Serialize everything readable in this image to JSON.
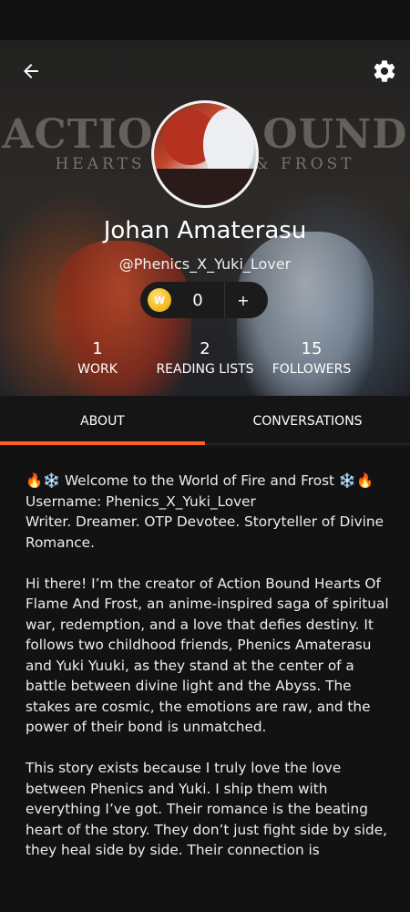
{
  "header": {
    "cover_title": "ACTIO",
    "cover_title_right": "OUND",
    "cover_subtitle_left": "HEARTS",
    "cover_subtitle_right": "& FROST",
    "back_icon": "arrow-left-icon",
    "settings_icon": "gear-icon"
  },
  "profile": {
    "display_name": "Johan Amaterasu",
    "username": "@Phenics_X_Yuki_Lover",
    "coins": "0",
    "coin_add_label": "+",
    "coin_badge": "W"
  },
  "stats": {
    "work": {
      "value": "1",
      "label": "WORK"
    },
    "reading_lists": {
      "value": "2",
      "label": "READING LISTS"
    },
    "followers": {
      "value": "15",
      "label": "FOLLOWERS"
    }
  },
  "tabs": {
    "about": "ABOUT",
    "conversations": "CONVERSATIONS",
    "active": "about",
    "accent_color": "#ff6122"
  },
  "about": {
    "intro": "🔥❄️ Welcome to the World of Fire and Frost ❄️🔥",
    "username_line": "Username: Phenics_X_Yuki_Lover",
    "tagline": "Writer. Dreamer. OTP Devotee. Storyteller of Divine Romance.",
    "paragraph1": "Hi there! I’m the creator of Action Bound Hearts Of Flame And Frost, an anime-inspired saga of spiritual war, redemption, and a love that defies destiny. It follows two childhood friends, Phenics Amaterasu and Yuki Yuuki, as they stand at the center of a battle between divine light and the Abyss. The stakes are cosmic, the emotions are raw, and the power of their bond is unmatched.",
    "paragraph2": "This story exists because I truly love the love between Phenics and Yuki. I ship them with everything I’ve got. Their romance is the beating heart of the story. They don’t just fight side by side, they heal side by side. Their connection is"
  }
}
